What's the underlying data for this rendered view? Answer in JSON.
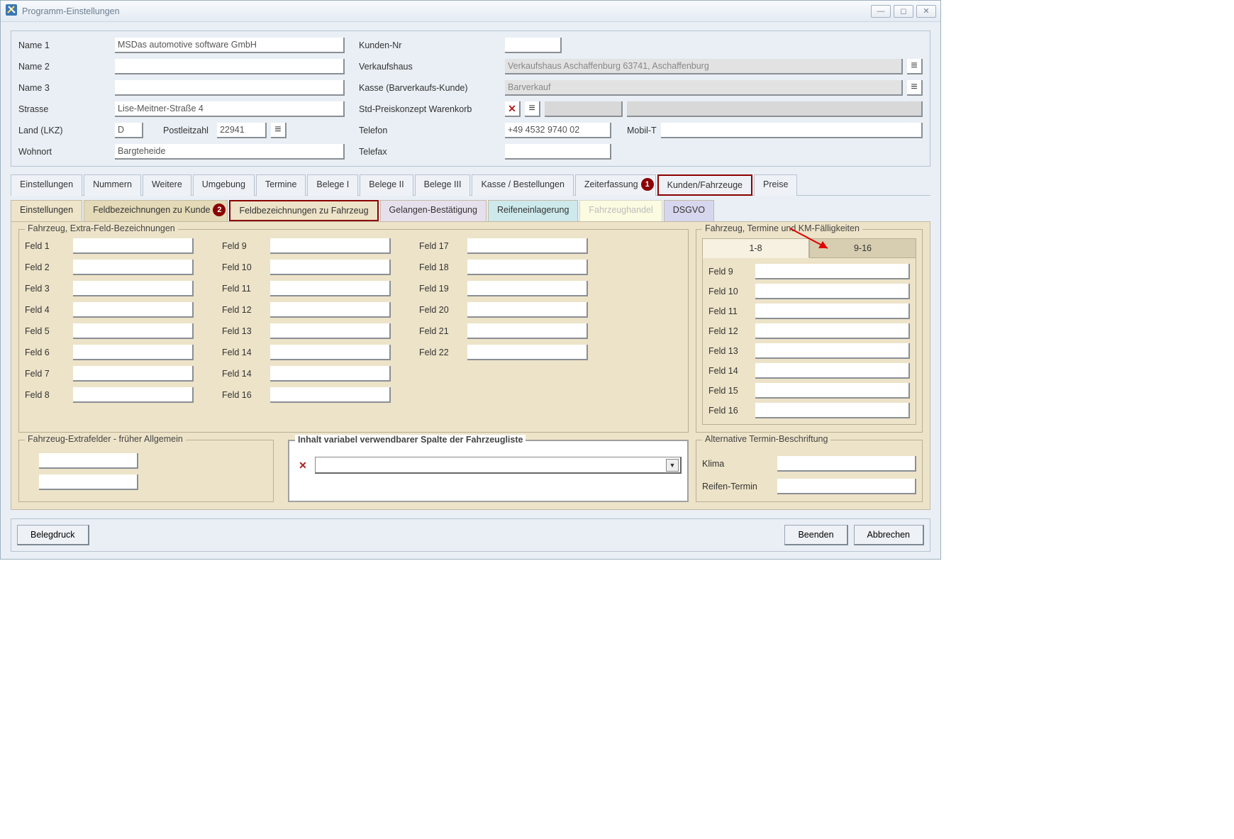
{
  "window": {
    "title": "Programm-Einstellungen"
  },
  "header": {
    "labels": {
      "name1": "Name 1",
      "name2": "Name 2",
      "name3": "Name 3",
      "strasse": "Strasse",
      "land": "Land (LKZ)",
      "plz": "Postleitzahl",
      "wohnort": "Wohnort",
      "kundennr": "Kunden-Nr",
      "verkaufshaus": "Verkaufshaus",
      "kasse": "Kasse (Barverkaufs-Kunde)",
      "preiskonzept": "Std-Preiskonzept Warenkorb",
      "telefon": "Telefon",
      "mobil": "Mobil-T",
      "telefax": "Telefax"
    },
    "values": {
      "name1": "MSDas automotive software GmbH",
      "name2": "",
      "name3": "",
      "strasse": "Lise-Meitner-Straße 4",
      "land": "D",
      "plz": "22941",
      "wohnort": "Bargteheide",
      "kundennr": "",
      "verkaufshaus": "Verkaufshaus Aschaffenburg 63741, Aschaffenburg",
      "kasse": "Barverkauf",
      "preiskonzept1": "",
      "preiskonzept2": "",
      "telefon": "+49 4532 9740 02",
      "mobil": "",
      "telefax": ""
    }
  },
  "tabs_main": [
    "Einstellungen",
    "Nummern",
    "Weitere",
    "Umgebung",
    "Termine",
    "Belege I",
    "Belege II",
    "Belege III",
    "Kasse / Bestellungen",
    "Zeiterfassung",
    "Kunden/Fahrzeuge",
    "Preise"
  ],
  "tabs_sub": {
    "einst": "Einstellungen",
    "fbk": "Feldbezeichnungen zu Kunde",
    "fbf": "Feldbezeichnungen zu Fahrzeug",
    "gel": "Gelangen-Bestätigung",
    "reifen": "Reifeneinlagerung",
    "fhz": "Fahrzeughandel",
    "dsgvo": "DSGVO"
  },
  "extra": {
    "legend": "Fahrzeug, Extra-Feld-Bezeichnungen",
    "col1": [
      "Feld 1",
      "Feld 2",
      "Feld 3",
      "Feld 4",
      "Feld 5",
      "Feld 6",
      "Feld 7",
      "Feld 8"
    ],
    "col2": [
      "Feld 9",
      "Feld 10",
      "Feld 11",
      "Feld 12",
      "Feld 13",
      "Feld 14",
      "Feld 14",
      "Feld 16"
    ],
    "col3": [
      "Feld 17",
      "Feld 18",
      "Feld 19",
      "Feld 20",
      "Feld 21",
      "Feld 22"
    ]
  },
  "termine": {
    "legend": "Fahrzeug, Termine und KM-Fälligkeiten",
    "tabs": {
      "a": "1-8",
      "b": "9-16"
    },
    "rows": [
      "Feld 9",
      "Feld 10",
      "Feld 11",
      "Feld 12",
      "Feld 13",
      "Feld 14",
      "Feld 15",
      "Feld 16"
    ]
  },
  "extrafelder": {
    "legend": "Fahrzeug-Extrafelder - früher Allgemein"
  },
  "varspalte": {
    "legend": "Inhalt variabel verwendbarer Spalte der Fahrzeugliste"
  },
  "alttermin": {
    "legend": "Alternative Termin-Beschriftung",
    "klima": "Klima",
    "reifen": "Reifen-Termin"
  },
  "footer": {
    "belegdruck": "Belegdruck",
    "beenden": "Beenden",
    "abbrechen": "Abbrechen"
  },
  "markers": {
    "m1": "1",
    "m2": "2"
  }
}
